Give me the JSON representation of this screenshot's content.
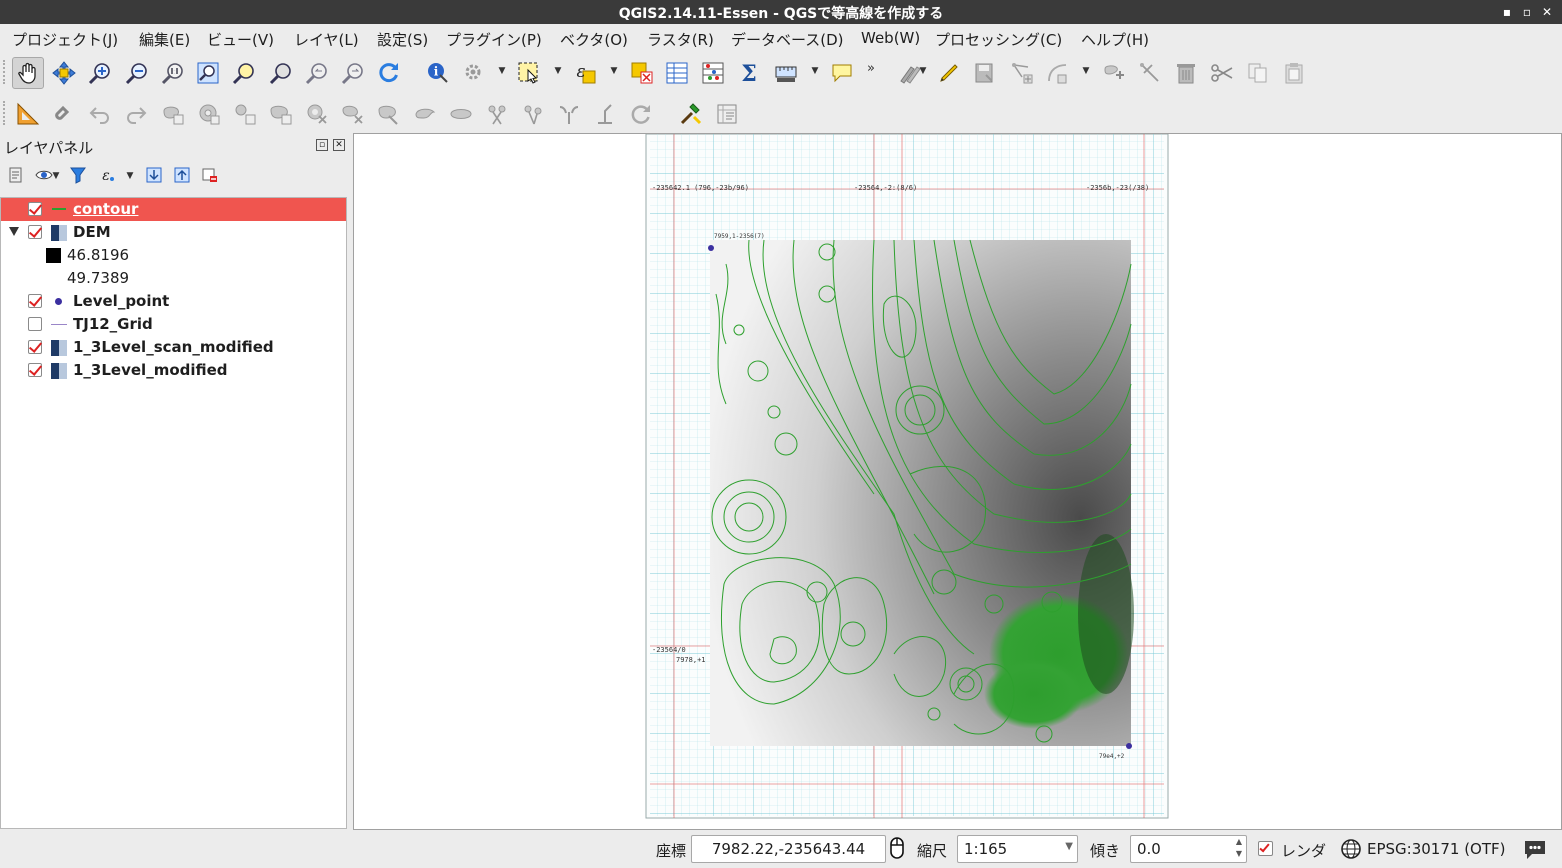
{
  "window": {
    "title": "QGIS2.14.11-Essen - QGSで等高線を作成する",
    "controls": [
      "▪",
      "▫",
      "✕"
    ]
  },
  "menu": [
    "プロジェクト(J)",
    "編集(E)",
    "ビュー(V)",
    "レイヤ(L)",
    "設定(S)",
    "プラグイン(P)",
    "ベクタ(O)",
    "ラスタ(R)",
    "データベース(D)",
    "Web(W)",
    "プロセッシング(C)",
    "ヘルプ(H)"
  ],
  "layer_panel": {
    "title": "レイヤパネル",
    "layers": [
      {
        "name": "contour",
        "checked": true,
        "selected": true,
        "symbol": "line-icon"
      },
      {
        "name": "DEM",
        "checked": true,
        "selected": false,
        "symbol": "raster-icon",
        "expanded": true
      },
      {
        "name": "Level_point",
        "checked": true,
        "selected": false,
        "symbol": "point-icon"
      },
      {
        "name": "TJ12_Grid",
        "checked": false,
        "selected": false,
        "symbol": "line-icon"
      },
      {
        "name": "1_3Level_scan_modified",
        "checked": true,
        "selected": false,
        "symbol": "raster-icon"
      },
      {
        "name": "1_3Level_modified",
        "checked": true,
        "selected": false,
        "symbol": "raster-icon"
      }
    ],
    "dem_legend": {
      "max": "46.8196",
      "min": "49.7389"
    }
  },
  "statusbar": {
    "coord_label": "座標",
    "coord_value": "7982.22,-235643.44",
    "scale_label": "縮尺",
    "scale_value": "1:165",
    "rotation_label": "傾き",
    "rotation_value": "0.0",
    "render_label": "レンダ",
    "crs_label": "EPSG:30171 (OTF)"
  },
  "colors": {
    "selection": "#f0554f",
    "contour": "#2ea02e",
    "titlebar": "#3a3a3a"
  }
}
